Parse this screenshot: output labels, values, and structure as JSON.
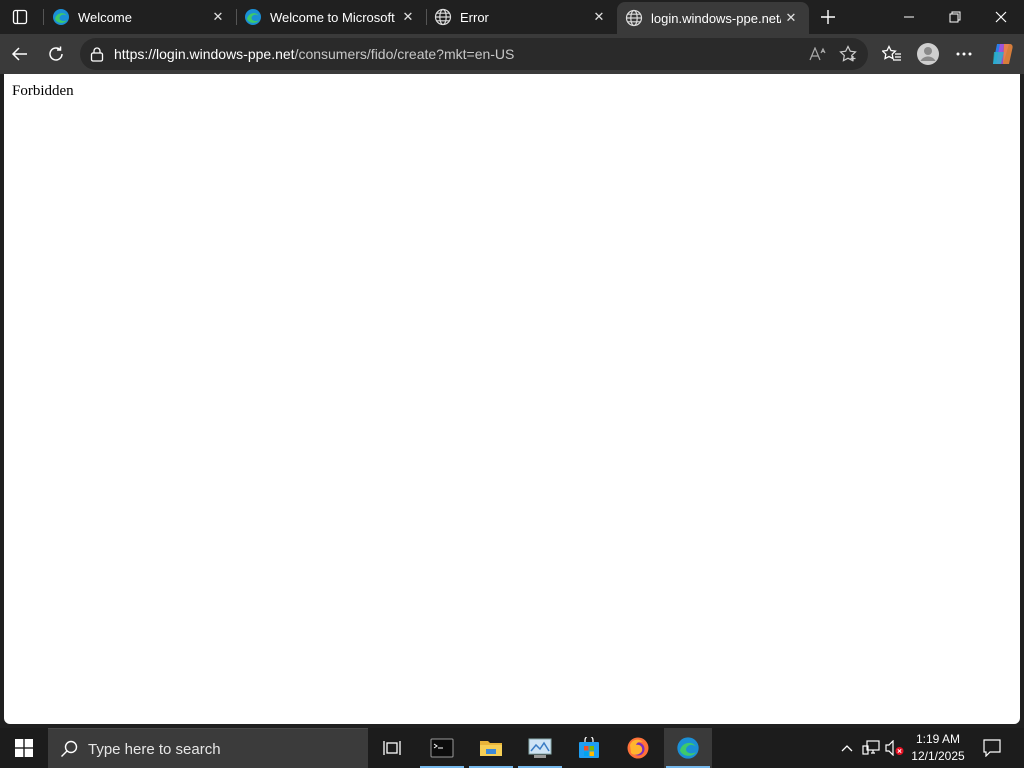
{
  "browser": {
    "tabs": [
      {
        "title": "Welcome",
        "favicon": "edge-icon",
        "active": false
      },
      {
        "title": "Welcome to Microsoft Ed",
        "favicon": "edge-icon",
        "active": false
      },
      {
        "title": "Error",
        "favicon": "globe-icon",
        "active": false
      },
      {
        "title": "login.windows-ppe.net/c",
        "favicon": "globe-icon",
        "active": true
      }
    ],
    "close_glyph": "✕",
    "url_host": "https://login.windows-ppe.net",
    "url_path": "/consumers/fido/create?mkt=en-US",
    "read_aloud_label": "Aᵃ"
  },
  "page": {
    "body_text": "Forbidden"
  },
  "taskbar": {
    "search_placeholder": "Type here to search",
    "clock_time": "1:19 AM",
    "clock_date": "12/1/2025",
    "accent_color": "#76b9ed"
  }
}
